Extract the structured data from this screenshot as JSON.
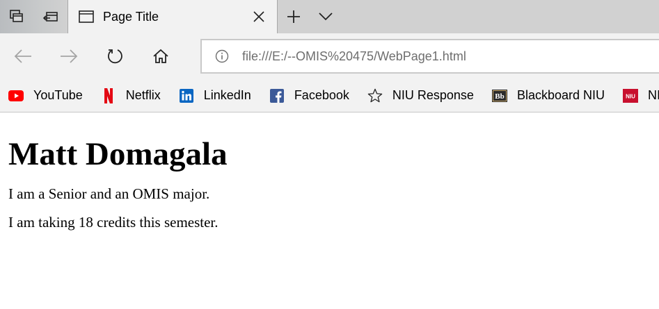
{
  "browser": {
    "tab": {
      "title": "Page Title"
    },
    "address": {
      "url": "file:///E:/--OMIS%20475/WebPage1.html"
    },
    "favorites": [
      {
        "label": "YouTube",
        "icon": "youtube-icon"
      },
      {
        "label": "Netflix",
        "icon": "netflix-icon"
      },
      {
        "label": "LinkedIn",
        "icon": "linkedin-icon"
      },
      {
        "label": "Facebook",
        "icon": "facebook-icon"
      },
      {
        "label": "NIU Response",
        "icon": "star-icon"
      },
      {
        "label": "Blackboard NIU",
        "icon": "blackboard-icon"
      },
      {
        "label": "NIU",
        "icon": "niu-icon"
      }
    ]
  },
  "page": {
    "heading": "Matt Domagala",
    "paragraphs": [
      "I am a Senior and an OMIS major.",
      "I am taking 18 credits this semester."
    ]
  },
  "colors": {
    "youtube": "#ff0000",
    "netflix": "#e50914",
    "linkedin": "#0a66c2",
    "facebook": "#3b5998",
    "niu": "#c8102e"
  }
}
